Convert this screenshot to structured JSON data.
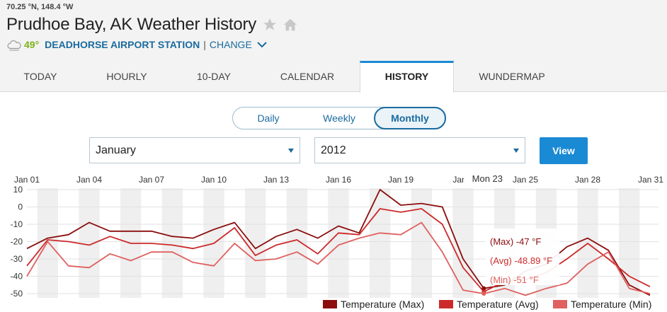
{
  "header": {
    "coords": "70.25 °N, 148.4 °W",
    "title": "Prudhoe Bay, AK Weather History",
    "current_temp": "49°",
    "station": "DEADHORSE AIRPORT STATION",
    "separator": "|",
    "change_label": "CHANGE",
    "icons": [
      "star-icon",
      "home-icon",
      "cloud-icon",
      "chevron-down-icon"
    ]
  },
  "tabs": [
    {
      "label": "TODAY",
      "active": false
    },
    {
      "label": "HOURLY",
      "active": false
    },
    {
      "label": "10-DAY",
      "active": false
    },
    {
      "label": "CALENDAR",
      "active": false
    },
    {
      "label": "HISTORY",
      "active": true
    },
    {
      "label": "WUNDERMAP",
      "active": false
    }
  ],
  "period_toggle": {
    "options": [
      "Daily",
      "Weekly",
      "Monthly"
    ],
    "selected": "Monthly"
  },
  "filters": {
    "month": "January",
    "year": "2012",
    "view_label": "View"
  },
  "colors": {
    "accent": "#1a8ad4",
    "link": "#1a6b9e",
    "max": "#8b0d0d",
    "avg": "#cc2a2a",
    "min": "#e06060"
  },
  "chart_data": {
    "type": "line",
    "x": [
      "Jan 01",
      "Jan 02",
      "Jan 03",
      "Jan 04",
      "Jan 05",
      "Jan 06",
      "Jan 07",
      "Jan 08",
      "Jan 09",
      "Jan 10",
      "Jan 11",
      "Jan 12",
      "Jan 13",
      "Jan 14",
      "Jan 15",
      "Jan 16",
      "Jan 17",
      "Jan 18",
      "Jan 19",
      "Jan 20",
      "Jan 21",
      "Jan 22",
      "Jan 23",
      "Jan 24",
      "Jan 25",
      "Jan 26",
      "Jan 27",
      "Jan 28",
      "Jan 29",
      "Jan 30",
      "Jan 31"
    ],
    "x_tick_labels": [
      "Jan 01",
      "Jan 04",
      "Jan 07",
      "Jan 10",
      "Jan 13",
      "Jan 16",
      "Jan 19",
      "Jan 2",
      "Jan 25",
      "Jan 28",
      "Jan 31"
    ],
    "y_ticks": [
      10,
      0,
      -10,
      -20,
      -30,
      -40,
      -50
    ],
    "ylim": [
      -51,
      10
    ],
    "series": [
      {
        "name": "Temperature (Max)",
        "color": "#8b0d0d",
        "values": [
          -24,
          -18,
          -16,
          -9,
          -14,
          -14,
          -14,
          -17,
          -18,
          -13,
          -9,
          -24,
          -17,
          -13,
          -18,
          -11,
          -15,
          10,
          1,
          2,
          0,
          -30,
          -47,
          -45,
          -37,
          -33,
          -23,
          -18,
          -25,
          -45,
          -51
        ]
      },
      {
        "name": "Temperature (Avg)",
        "color": "#cc2a2a",
        "values": [
          -34,
          -19,
          -20,
          -22,
          -17,
          -21,
          -21,
          -22,
          -24,
          -21,
          -12,
          -28,
          -22,
          -19,
          -27,
          -15,
          -16,
          -1,
          -3,
          -1,
          -10,
          -35,
          -48.89,
          -43,
          -42,
          -38,
          -30,
          -21,
          -30,
          -40,
          -46
        ]
      },
      {
        "name": "Temperature (Min)",
        "color": "#e06060",
        "values": [
          -40,
          -20,
          -34,
          -35,
          -27,
          -31,
          -26,
          -26,
          -32,
          -34,
          -21,
          -31,
          -30,
          -26,
          -33,
          -22,
          -18,
          -15,
          -16,
          -9,
          -26,
          -48,
          -50,
          -47,
          -51,
          -47,
          -44,
          -33,
          -26,
          -47,
          -50
        ]
      }
    ],
    "hover": {
      "label": "Mon 23",
      "index": 22,
      "max": "(Max) -47 °F",
      "avg": "(Avg) -48.89 °F",
      "min": "(Min) -51 °F"
    },
    "legend_position": "bottom-right",
    "alternating_day_bands": true
  }
}
